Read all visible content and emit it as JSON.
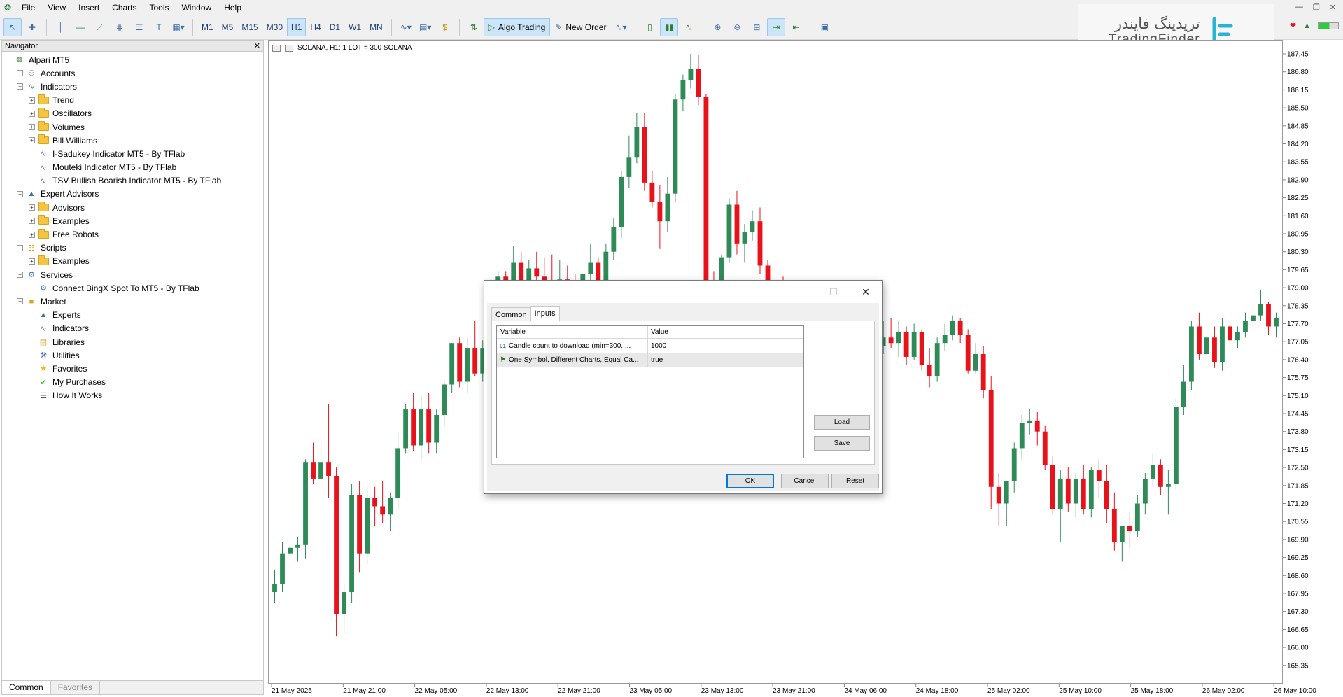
{
  "menu": [
    "File",
    "View",
    "Insert",
    "Charts",
    "Tools",
    "Window",
    "Help"
  ],
  "toolbar": {
    "timeframes": [
      "M1",
      "M5",
      "M15",
      "M30",
      "H1",
      "H4",
      "D1",
      "W1",
      "MN"
    ],
    "active_timeframe": "H1",
    "algo_trading": "Algo Trading",
    "new_order": "New Order"
  },
  "logo": {
    "persian": "تریدینگ فایندر",
    "english": "TradingFinder",
    "color": "#2bb3d6"
  },
  "navigator": {
    "title": "Navigator",
    "tree": [
      {
        "label": "Alpari MT5",
        "level": 0,
        "icon": "broker-icon",
        "exp": ""
      },
      {
        "label": "Accounts",
        "level": 1,
        "icon": "accounts-icon",
        "exp": "+"
      },
      {
        "label": "Indicators",
        "level": 1,
        "icon": "indicator-icon",
        "exp": "-"
      },
      {
        "label": "Trend",
        "level": 2,
        "icon": "folder-icon",
        "exp": "+"
      },
      {
        "label": "Oscillators",
        "level": 2,
        "icon": "folder-icon",
        "exp": "+"
      },
      {
        "label": "Volumes",
        "level": 2,
        "icon": "folder-icon",
        "exp": "+"
      },
      {
        "label": "Bill Williams",
        "level": 2,
        "icon": "folder-icon",
        "exp": "+"
      },
      {
        "label": "I-Sadukey Indicator MT5 - By TFlab",
        "level": 2,
        "icon": "indicator-icon",
        "exp": ""
      },
      {
        "label": "Mouteki Indicator MT5 - By TFlab",
        "level": 2,
        "icon": "indicator-icon",
        "exp": ""
      },
      {
        "label": "TSV Bullish Bearish Indicator MT5 - By TFlab",
        "level": 2,
        "icon": "indicator-icon",
        "exp": ""
      },
      {
        "label": "Expert Advisors",
        "level": 1,
        "icon": "expert-icon",
        "exp": "-"
      },
      {
        "label": "Advisors",
        "level": 2,
        "icon": "folder-icon",
        "exp": "+"
      },
      {
        "label": "Examples",
        "level": 2,
        "icon": "folder-icon",
        "exp": "+"
      },
      {
        "label": "Free Robots",
        "level": 2,
        "icon": "folder-icon",
        "exp": "+"
      },
      {
        "label": "Scripts",
        "level": 1,
        "icon": "script-icon",
        "exp": "-"
      },
      {
        "label": "Examples",
        "level": 2,
        "icon": "folder-icon",
        "exp": "+"
      },
      {
        "label": "Services",
        "level": 1,
        "icon": "services-icon",
        "exp": "-"
      },
      {
        "label": "Connect BingX Spot To MT5 - By TFlab",
        "level": 2,
        "icon": "services-icon",
        "exp": ""
      },
      {
        "label": "Market",
        "level": 1,
        "icon": "market-icon",
        "exp": "-"
      },
      {
        "label": "Experts",
        "level": 2,
        "icon": "expert-icon",
        "exp": ""
      },
      {
        "label": "Indicators",
        "level": 2,
        "icon": "indicator-icon",
        "exp": ""
      },
      {
        "label": "Libraries",
        "level": 2,
        "icon": "library-icon",
        "exp": ""
      },
      {
        "label": "Utilities",
        "level": 2,
        "icon": "utility-icon",
        "exp": ""
      },
      {
        "label": "Favorites",
        "level": 2,
        "icon": "star-icon",
        "exp": ""
      },
      {
        "label": "My Purchases",
        "level": 2,
        "icon": "check-icon",
        "exp": ""
      },
      {
        "label": "How It Works",
        "level": 2,
        "icon": "list-icon",
        "exp": ""
      }
    ],
    "tabs": [
      "Common",
      "Favorites"
    ]
  },
  "chart": {
    "symbol_label": "SOLANA, H1:  1 LOT = 300 SOLANA",
    "bull_color": "#2e8b57",
    "bear_color": "#e8121b"
  },
  "chart_data": {
    "type": "candlestick",
    "symbol": "SOLANA",
    "timeframe": "H1",
    "price_axis": [
      "187.45",
      "186.80",
      "186.15",
      "185.50",
      "184.85",
      "184.20",
      "183.55",
      "182.90",
      "182.25",
      "181.60",
      "180.95",
      "180.30",
      "179.65",
      "179.00",
      "178.35",
      "177.70",
      "177.05",
      "176.40",
      "175.75",
      "175.10",
      "174.45",
      "173.80",
      "173.15",
      "172.50",
      "171.85",
      "171.20",
      "170.55",
      "169.90",
      "169.25",
      "168.60",
      "167.95",
      "167.30",
      "166.65",
      "166.00",
      "165.35"
    ],
    "time_axis": [
      "21 May 2025",
      "21 May 21:00",
      "22 May 05:00",
      "22 May 13:00",
      "22 May 21:00",
      "23 May 05:00",
      "23 May 13:00",
      "23 May 21:00",
      "24 May 06:00",
      "24 May 18:00",
      "25 May 02:00",
      "25 May 10:00",
      "25 May 18:00",
      "26 May 02:00",
      "26 May 10:00"
    ],
    "ylim": [
      165.0,
      187.8
    ],
    "candles": [
      [
        168.0,
        168.8,
        167.6,
        168.3
      ],
      [
        168.3,
        169.8,
        168.0,
        169.4
      ],
      [
        169.4,
        170.2,
        169.0,
        169.6
      ],
      [
        169.6,
        170.0,
        169.1,
        169.7
      ],
      [
        169.7,
        172.8,
        169.2,
        172.7
      ],
      [
        172.7,
        173.4,
        171.9,
        172.1
      ],
      [
        172.1,
        173.6,
        171.8,
        172.7
      ],
      [
        172.7,
        174.8,
        171.4,
        172.2
      ],
      [
        172.2,
        172.5,
        166.4,
        167.2
      ],
      [
        167.2,
        168.3,
        166.5,
        168.0
      ],
      [
        168.0,
        171.9,
        167.6,
        171.5
      ],
      [
        171.5,
        172.0,
        168.7,
        169.4
      ],
      [
        169.4,
        171.8,
        169.0,
        171.4
      ],
      [
        171.4,
        171.8,
        170.4,
        171.1
      ],
      [
        171.1,
        172.0,
        170.5,
        170.8
      ],
      [
        170.8,
        171.6,
        170.2,
        171.4
      ],
      [
        171.4,
        173.8,
        171.0,
        173.2
      ],
      [
        173.2,
        174.8,
        173.0,
        174.6
      ],
      [
        174.6,
        175.2,
        173.1,
        173.3
      ],
      [
        173.3,
        175.1,
        172.8,
        174.6
      ],
      [
        174.6,
        175.2,
        173.0,
        173.4
      ],
      [
        173.4,
        174.6,
        173.0,
        174.4
      ],
      [
        174.4,
        175.6,
        174.0,
        175.5
      ],
      [
        175.5,
        177.0,
        175.2,
        177.0
      ],
      [
        177.0,
        177.2,
        175.4,
        175.6
      ],
      [
        175.6,
        177.2,
        175.2,
        176.8
      ],
      [
        176.8,
        177.8,
        175.8,
        175.9
      ],
      [
        175.9,
        177.1,
        175.6,
        176.8
      ],
      [
        176.8,
        178.1,
        176.6,
        178.0
      ],
      [
        178.0,
        179.6,
        177.4,
        179.4
      ],
      [
        179.4,
        179.6,
        178.4,
        179.2
      ],
      [
        179.2,
        180.5,
        178.5,
        179.9
      ],
      [
        179.9,
        180.3,
        179.0,
        179.2
      ],
      [
        179.2,
        180.0,
        178.6,
        179.7
      ],
      [
        179.7,
        180.3,
        178.9,
        179.4
      ],
      [
        179.4,
        180.1,
        178.8,
        179.1
      ],
      [
        179.1,
        180.2,
        178.5,
        179.0
      ],
      [
        179.0,
        180.0,
        178.7,
        179.3
      ],
      [
        179.3,
        179.8,
        178.4,
        179.1
      ],
      [
        179.1,
        179.5,
        178.2,
        179.0
      ],
      [
        179.0,
        179.3,
        178.0,
        179.5
      ],
      [
        179.5,
        180.6,
        179.0,
        179.9
      ],
      [
        179.9,
        180.1,
        178.9,
        179.2
      ],
      [
        179.2,
        180.6,
        179.0,
        180.3
      ],
      [
        180.3,
        181.5,
        180.0,
        181.2
      ],
      [
        181.2,
        183.2,
        180.8,
        183.0
      ],
      [
        183.0,
        184.5,
        182.6,
        183.7
      ],
      [
        183.7,
        185.3,
        183.5,
        184.8
      ],
      [
        184.8,
        185.3,
        182.5,
        182.8
      ],
      [
        182.8,
        183.2,
        181.9,
        182.1
      ],
      [
        182.1,
        182.7,
        180.4,
        181.4
      ],
      [
        181.4,
        183.0,
        181.0,
        182.4
      ],
      [
        182.4,
        186.0,
        182.1,
        185.8
      ],
      [
        185.8,
        186.7,
        185.4,
        186.5
      ],
      [
        186.5,
        187.6,
        186.2,
        186.9
      ],
      [
        186.9,
        187.4,
        185.6,
        185.9
      ],
      [
        185.9,
        186.0,
        178.4,
        178.8
      ],
      [
        178.8,
        179.6,
        177.8,
        178.6
      ],
      [
        178.6,
        180.2,
        178.1,
        180.1
      ],
      [
        180.1,
        182.2,
        179.9,
        182.0
      ],
      [
        182.0,
        182.5,
        180.2,
        180.6
      ],
      [
        180.6,
        181.3,
        179.9,
        181.0
      ],
      [
        181.0,
        181.8,
        180.7,
        181.4
      ],
      [
        181.4,
        181.9,
        179.5,
        179.8
      ],
      [
        179.8,
        180.0,
        178.3,
        178.5
      ],
      [
        178.5,
        179.2,
        178.0,
        178.9
      ],
      [
        178.9,
        179.4,
        177.8,
        178.0
      ],
      [
        178.0,
        178.6,
        176.9,
        177.2
      ],
      [
        177.2,
        177.7,
        176.5,
        177.0
      ],
      [
        177.0,
        177.6,
        176.4,
        176.8
      ],
      [
        176.8,
        177.4,
        175.4,
        175.6
      ],
      [
        175.6,
        177.3,
        175.3,
        177.0
      ],
      [
        177.0,
        177.5,
        176.2,
        176.6
      ],
      [
        176.6,
        177.3,
        176.1,
        176.9
      ],
      [
        176.9,
        177.6,
        176.4,
        177.0
      ],
      [
        177.0,
        177.4,
        176.3,
        176.7
      ],
      [
        176.7,
        177.1,
        176.0,
        176.5
      ],
      [
        176.5,
        177.2,
        176.1,
        176.7
      ],
      [
        176.7,
        177.4,
        176.1,
        176.9
      ],
      [
        176.9,
        177.8,
        176.6,
        177.2
      ],
      [
        177.2,
        177.9,
        176.8,
        177.0
      ],
      [
        177.0,
        177.8,
        176.5,
        177.4
      ],
      [
        177.4,
        177.6,
        176.2,
        176.5
      ],
      [
        176.5,
        177.7,
        176.4,
        177.4
      ],
      [
        177.4,
        177.5,
        176.0,
        176.2
      ],
      [
        176.2,
        176.8,
        175.4,
        175.8
      ],
      [
        175.8,
        177.2,
        175.6,
        177.0
      ],
      [
        177.0,
        177.7,
        176.7,
        177.3
      ],
      [
        177.3,
        178.0,
        177.1,
        177.8
      ],
      [
        177.8,
        177.9,
        177.0,
        177.3
      ],
      [
        177.3,
        177.5,
        175.9,
        176.0
      ],
      [
        176.0,
        177.0,
        175.9,
        176.6
      ],
      [
        176.6,
        176.9,
        175.0,
        175.3
      ],
      [
        175.3,
        175.8,
        171.0,
        171.8
      ],
      [
        171.8,
        172.3,
        170.4,
        171.2
      ],
      [
        171.2,
        172.0,
        170.4,
        172.0
      ],
      [
        172.0,
        173.4,
        171.6,
        173.2
      ],
      [
        173.2,
        174.4,
        172.8,
        174.1
      ],
      [
        174.1,
        174.6,
        173.7,
        174.2
      ],
      [
        174.2,
        174.5,
        173.3,
        173.8
      ],
      [
        173.8,
        174.0,
        172.4,
        172.6
      ],
      [
        172.6,
        172.9,
        170.8,
        171.0
      ],
      [
        171.0,
        172.4,
        169.8,
        172.1
      ],
      [
        172.1,
        172.5,
        170.9,
        171.2
      ],
      [
        171.2,
        172.3,
        170.7,
        172.1
      ],
      [
        172.1,
        172.6,
        170.8,
        171.0
      ],
      [
        171.0,
        172.5,
        170.7,
        172.4
      ],
      [
        172.4,
        172.8,
        171.4,
        172.0
      ],
      [
        172.0,
        172.6,
        170.5,
        171.0
      ],
      [
        171.0,
        171.6,
        169.5,
        169.8
      ],
      [
        169.8,
        170.4,
        169.1,
        170.4
      ],
      [
        170.4,
        170.9,
        169.6,
        170.2
      ],
      [
        170.2,
        171.5,
        170.0,
        171.2
      ],
      [
        171.2,
        172.3,
        170.8,
        172.1
      ],
      [
        172.1,
        173.0,
        171.8,
        172.6
      ],
      [
        172.6,
        172.8,
        171.5,
        171.8
      ],
      [
        171.8,
        172.4,
        170.8,
        171.9
      ],
      [
        171.9,
        175.0,
        171.7,
        174.7
      ],
      [
        174.7,
        176.2,
        174.4,
        175.6
      ],
      [
        175.6,
        177.8,
        175.3,
        177.6
      ],
      [
        177.6,
        178.1,
        176.4,
        176.6
      ],
      [
        176.6,
        177.3,
        176.3,
        177.2
      ],
      [
        177.2,
        177.6,
        176.1,
        176.3
      ],
      [
        176.3,
        177.9,
        176.0,
        177.6
      ],
      [
        177.6,
        177.8,
        176.8,
        177.1
      ],
      [
        177.1,
        177.6,
        176.8,
        177.4
      ],
      [
        177.4,
        178.1,
        177.2,
        177.8
      ],
      [
        177.8,
        178.4,
        177.4,
        178.0
      ],
      [
        178.0,
        178.9,
        177.8,
        178.4
      ],
      [
        178.4,
        178.5,
        177.3,
        177.6
      ],
      [
        177.6,
        178.1,
        177.2,
        177.9
      ]
    ]
  },
  "dialog": {
    "tabs": [
      "Common",
      "Inputs"
    ],
    "active_tab": "Inputs",
    "table": {
      "headers": [
        "Variable",
        "Value"
      ],
      "rows": [
        {
          "icon": "01",
          "variable": "Candle count to download (min=300, ...",
          "value": "1000"
        },
        {
          "icon": "flag",
          "variable": "One Symbol, Different Charts, Equal Ca...",
          "value": "true"
        }
      ]
    },
    "buttons": {
      "load": "Load",
      "save": "Save",
      "ok": "OK",
      "cancel": "Cancel",
      "reset": "Reset"
    }
  }
}
